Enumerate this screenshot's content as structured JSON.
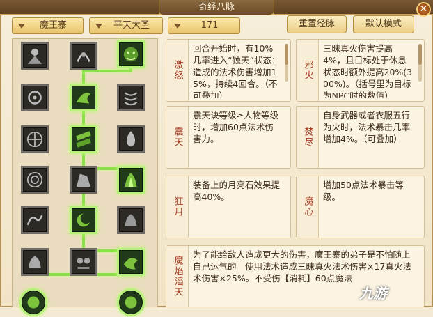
{
  "window": {
    "title": "奇经八脉"
  },
  "filters": {
    "school": "魔王寨",
    "master": "平天大圣",
    "level": "171"
  },
  "toolbar": {
    "reset_label": "重置经脉",
    "default_label": "默认模式"
  },
  "skills": [
    {
      "name": "激怒",
      "desc": "回合开始时，有10%几率进入“蚀天”状态：造成的法术伤害增加15%，持续4回合。（不可叠加）"
    },
    {
      "name": "邪火",
      "desc": "三昧真火伤害提高4%，且目标处于休息状态时额外提高20%(300%)。（括号里为目标为NPC时的数值）"
    },
    {
      "name": "震天",
      "desc": "震天诀等级≥人物等级时，增加60点法术伤害力。"
    },
    {
      "name": "焚尽",
      "desc": "自身武器或者衣服五行为火时，法术暴击几率增加4%。（可叠加）"
    },
    {
      "name": "狂月",
      "desc": "装备上的月亮石效果提高40%。"
    },
    {
      "name": "魔心",
      "desc": "增加50点法术暴击等级。"
    },
    {
      "name": "魔焰滔天",
      "desc": "为了能给敌人造成更大的伤害，魔王寨的弟子是不怕随上自己运气的。使用法术造成三昧真火法术伤害×17真火法术伤害×25%。不受伤【消耗】60点魔法"
    }
  ],
  "watermark": "九游",
  "icons": {
    "close": "close-icon",
    "dropdown": "chevron-down-icon",
    "nodes": "skill-node-icon"
  },
  "colors": {
    "active_glow": "#b8ff6a",
    "skill_name": "#a13a22",
    "titlebar": "#6b4a27"
  }
}
